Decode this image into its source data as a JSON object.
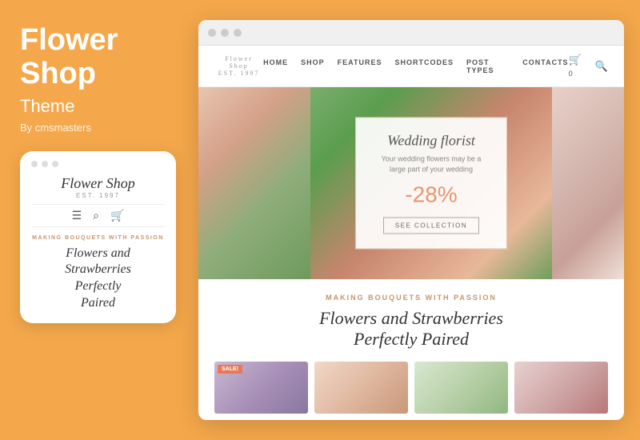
{
  "left": {
    "title_line1": "Flower",
    "title_line2": "Shop",
    "subtitle": "Theme",
    "author": "By cmsmasters",
    "mobile": {
      "logo": "Flower Shop",
      "est": "EST. 1997",
      "tagline": "MAKING BOUQUETS WITH PASSION",
      "hero_text_line1": "Flowers and",
      "hero_text_line2": "Strawberries",
      "hero_text_line3": "Perfectly",
      "hero_text_line4": "Paired"
    }
  },
  "browser": {
    "nav": {
      "items": [
        "HOME",
        "SHOP",
        "FEATURES",
        "SHORTCODES",
        "POST TYPES",
        "CONTACTS"
      ]
    },
    "logo": "Flower Shop",
    "logo_est": "EST. 1997",
    "hero": {
      "card_title": "Wedding florist",
      "card_subtitle": "Your wedding flowers may be a large part of your wedding",
      "discount": "-28%",
      "btn_label": "SEE COLLECTION"
    },
    "content": {
      "tagline": "MAKING BOUQUETS WITH PASSION",
      "title_line1": "Flowers and Strawberries",
      "title_line2": "Perfectly Paired"
    },
    "products": [
      {
        "sale": true
      },
      {
        "sale": false
      },
      {
        "sale": false
      },
      {
        "sale": false
      }
    ]
  }
}
